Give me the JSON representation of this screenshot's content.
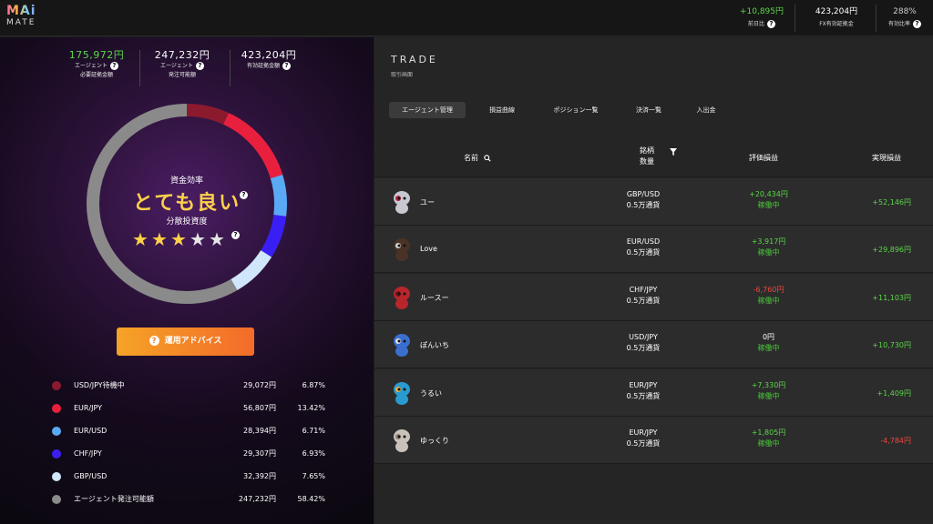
{
  "logo": {
    "line1": "MAi",
    "line2": "MATE"
  },
  "top_stats": [
    {
      "value": "+10,895円",
      "label": "前日比",
      "color": "#5cd64a"
    },
    {
      "value": "423,204円",
      "label": "FX有効証拠金",
      "color": "#ffffff"
    },
    {
      "value": "288%",
      "label": "有効比率",
      "color": "#cccccc"
    }
  ],
  "left_stats": [
    {
      "value": "175,972円",
      "label1": "エージェント",
      "label2": "必要証拠金額",
      "color": "#5cd64a"
    },
    {
      "value": "247,232円",
      "label1": "エージェント",
      "label2": "発注可能額",
      "color": "#ffffff"
    },
    {
      "value": "423,204円",
      "label1": "有効証拠金額",
      "label2": "",
      "color": "#ffffff"
    }
  ],
  "efficiency": {
    "heading": "資金効率",
    "rating": "とても良い",
    "diversity_label": "分散投資度",
    "stars_on": 3,
    "stars_total": 5
  },
  "advice_button": "運用アドバイス",
  "allocation": [
    {
      "name": "USD/JPY待機中",
      "amount": "29,072円",
      "pct": "6.87%",
      "color": "#8c1a2e"
    },
    {
      "name": "EUR/JPY",
      "amount": "56,807円",
      "pct": "13.42%",
      "color": "#e8203e"
    },
    {
      "name": "EUR/USD",
      "amount": "28,394円",
      "pct": "6.71%",
      "color": "#5aa9f5"
    },
    {
      "name": "CHF/JPY",
      "amount": "29,307円",
      "pct": "6.93%",
      "color": "#3a1ff5"
    },
    {
      "name": "GBP/USD",
      "amount": "32,392円",
      "pct": "7.65%",
      "color": "#cfe6fb"
    },
    {
      "name": "エージェント発注可能額",
      "amount": "247,232円",
      "pct": "58.42%",
      "color": "#8a8a8a"
    }
  ],
  "donut_fractions": [
    0.0687,
    0.1342,
    0.0671,
    0.0693,
    0.0765,
    0.5842
  ],
  "trade": {
    "title": "TRADE",
    "subtitle": "取引画面",
    "tabs": [
      "エージェント管理",
      "損益曲線",
      "ポジション一覧",
      "決済一覧",
      "入出金"
    ],
    "headers": {
      "name": "名前",
      "symbol": "銘柄",
      "size": "数量",
      "unrealized": "評価損益",
      "realized": "実現損益"
    }
  },
  "agents": [
    {
      "name": "ユー",
      "pair": "GBP/USD",
      "size": "0.5万通貨",
      "unrealized": "+20,434円",
      "status": "稼働中",
      "realized": "+52,146円",
      "u_sign": "pos",
      "r_sign": "pos",
      "avatar_color": "#c8c8d0",
      "avatar_accent": "#b0213a"
    },
    {
      "name": "Love",
      "pair": "EUR/USD",
      "size": "0.5万通貨",
      "unrealized": "+3,917円",
      "status": "稼働中",
      "realized": "+29,896円",
      "u_sign": "pos",
      "r_sign": "pos",
      "avatar_color": "#4a3226",
      "avatar_accent": "#d8d8d8"
    },
    {
      "name": "ルースー",
      "pair": "CHF/JPY",
      "size": "0.5万通貨",
      "unrealized": "-6,760円",
      "status": "稼働中",
      "realized": "+11,103円",
      "u_sign": "neg",
      "r_sign": "pos",
      "avatar_color": "#b8262c",
      "avatar_accent": "#6a1418"
    },
    {
      "name": "ぽんいち",
      "pair": "USD/JPY",
      "size": "0.5万通貨",
      "unrealized": "0円",
      "status": "稼働中",
      "realized": "+10,730円",
      "u_sign": "zero",
      "r_sign": "pos",
      "avatar_color": "#3a6fd0",
      "avatar_accent": "#e0e0e8"
    },
    {
      "name": "うるい",
      "pair": "EUR/JPY",
      "size": "0.5万通貨",
      "unrealized": "+7,330円",
      "status": "稼働中",
      "realized": "+1,409円",
      "u_sign": "pos",
      "r_sign": "pos",
      "avatar_color": "#2a9bd0",
      "avatar_accent": "#f0b03a"
    },
    {
      "name": "ゆっくり",
      "pair": "EUR/JPY",
      "size": "0.5万通貨",
      "unrealized": "+1,805円",
      "status": "稼働中",
      "realized": "-4,784円",
      "u_sign": "pos",
      "r_sign": "neg",
      "avatar_color": "#c9c2bb",
      "avatar_accent": "#8a7f77"
    }
  ]
}
